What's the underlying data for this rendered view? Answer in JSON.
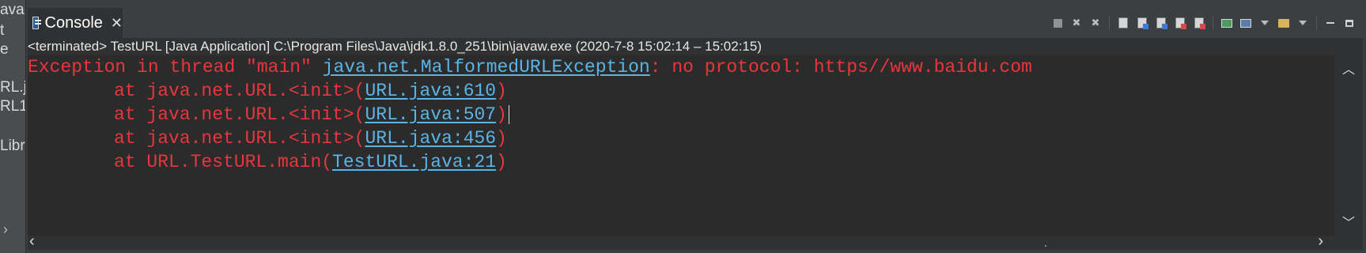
{
  "sidebar": {
    "fragments": [
      "ava",
      "t",
      "e",
      "RL.ja",
      "RL1",
      "Libr"
    ]
  },
  "console_view": {
    "tab_label": "Console",
    "tab_close": "✕",
    "status": "<terminated> TestURL [Java Application] C:\\Program Files\\Java\\jdk1.8.0_251\\bin\\javaw.exe  (2020-7-8 15:02:14 – 15:02:15)",
    "toolbar": [
      "terminate",
      "remove-launch",
      "remove-all-terminated",
      "scroll-lock",
      "word-wrap",
      "show-on-stdout",
      "show-on-stderr",
      "pin-console",
      "display-selected-console",
      "open-console",
      "minimize",
      "maximize"
    ]
  },
  "output": {
    "line1_prefix": "Exception in thread \"main\" ",
    "line1_link": "java.net.MalformedURLException",
    "line1_suffix": ": no protocol: https//www.baidu.com",
    "at_prefix": "at ",
    "frames": [
      {
        "method": "java.net.URL.<init>(",
        "link": "URL.java:610",
        "close": ")"
      },
      {
        "method": "java.net.URL.<init>(",
        "link": "URL.java:507",
        "close": ")"
      },
      {
        "method": "java.net.URL.<init>(",
        "link": "URL.java:456",
        "close": ")"
      },
      {
        "method": "URL.TestURL.main(",
        "link": "TestURL.java:21",
        "close": ")"
      }
    ]
  },
  "colors": {
    "error_text": "#e8363d",
    "link": "#5ab4e6",
    "console_bg": "#2b2b2b"
  }
}
